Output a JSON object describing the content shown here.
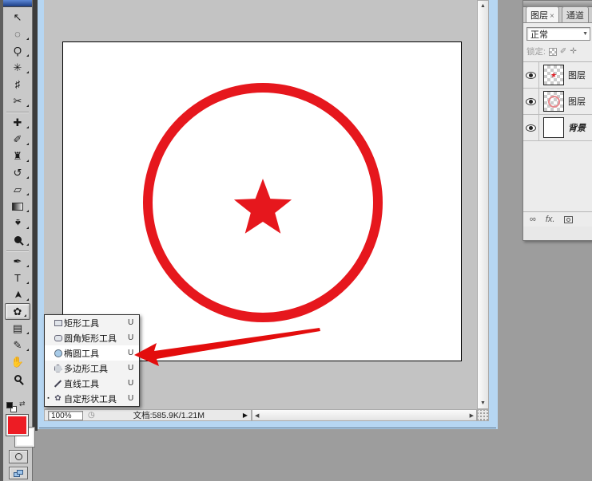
{
  "toolbox": {
    "tools": [
      {
        "name": "move-tool",
        "glyph": "↖"
      },
      {
        "name": "elliptical-marquee-tool",
        "glyph": "◌"
      },
      {
        "name": "lasso-tool",
        "glyph": "Ϙ"
      },
      {
        "name": "magic-wand-tool",
        "glyph": "✳"
      },
      {
        "name": "crop-tool",
        "glyph": "♯"
      },
      {
        "name": "slice-tool",
        "glyph": "✂"
      },
      {
        "name": "spot-healing-brush-tool",
        "glyph": "✚"
      },
      {
        "name": "brush-tool",
        "glyph": "✐"
      },
      {
        "name": "clone-stamp-tool",
        "glyph": "♜"
      },
      {
        "name": "history-brush-tool",
        "glyph": "↺"
      },
      {
        "name": "eraser-tool",
        "glyph": "▱"
      },
      {
        "name": "blur-tool",
        "glyph": "♠"
      },
      {
        "name": "pen-tool",
        "glyph": "✒"
      },
      {
        "name": "type-tool",
        "glyph": "T"
      },
      {
        "name": "path-selection-tool",
        "glyph": "➤"
      },
      {
        "name": "shape-tool",
        "glyph": "✿"
      },
      {
        "name": "notes-tool",
        "glyph": "▤"
      },
      {
        "name": "eyedropper-tool",
        "glyph": "✎"
      },
      {
        "name": "hand-tool",
        "glyph": "✋"
      }
    ],
    "swap_arrows_glyph": "⇄",
    "foreground_color": "#ed1c24",
    "background_color": "#ffffff"
  },
  "shape_menu": {
    "items": [
      {
        "label": "矩形工具",
        "shortcut": "U"
      },
      {
        "label": "圆角矩形工具",
        "shortcut": "U"
      },
      {
        "label": "椭圆工具",
        "shortcut": "U"
      },
      {
        "label": "多边形工具",
        "shortcut": "U"
      },
      {
        "label": "直线工具",
        "shortcut": "U"
      },
      {
        "label": "自定形状工具",
        "shortcut": "U"
      }
    ],
    "current_bullet": "▪"
  },
  "document_window": {
    "zoom_level": "100%",
    "status_icon_glyph": "◷",
    "doc_info": "文档:585.9K/1.21M",
    "status_popup_glyph": "▶",
    "scroll_up_glyph": "▲",
    "scroll_down_glyph": "▼",
    "scroll_left_glyph": "◀",
    "scroll_right_glyph": "▶",
    "canvas_shapes": [
      "red-circle-outline",
      "red-star"
    ],
    "shape_color": "#e6171d"
  },
  "annotation": {
    "arrow_color": "#e30d0d"
  },
  "layers_panel": {
    "tabs": {
      "layers_label": "图层",
      "layers_close": "×",
      "channels_label": "通道"
    },
    "blend_mode": "正常",
    "blend_dropdown_glyph": "▼",
    "lock_label": "锁定:",
    "lock_brush_glyph": "✐",
    "lock_move_glyph": "✛",
    "layers": [
      {
        "name": "图层"
      },
      {
        "name": "图层"
      },
      {
        "name": "背景"
      }
    ],
    "footer": {
      "link_glyph": "∞",
      "fx_label": "fx."
    }
  }
}
